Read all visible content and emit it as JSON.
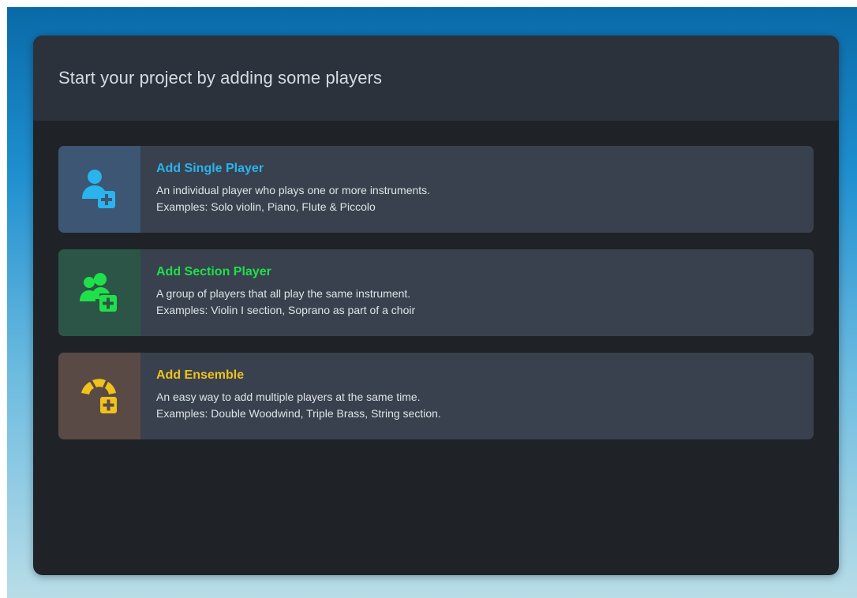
{
  "dialog": {
    "title": "Start your project by adding some players"
  },
  "options": [
    {
      "title": "Add Single Player",
      "line1": "An individual player who plays one or more instruments.",
      "line2": "Examples: Solo violin, Piano, Flute & Piccolo",
      "icon": "single-player-add-icon",
      "accent": "#2bb3ee"
    },
    {
      "title": "Add Section Player",
      "line1": "A group of players that all play the same instrument.",
      "line2": "Examples: Violin I section, Soprano as part of a choir",
      "icon": "section-player-add-icon",
      "accent": "#1fe04a"
    },
    {
      "title": "Add Ensemble",
      "line1": "An easy way to add multiple players at the same time.",
      "line2": "Examples: Double Woodwind, Triple Brass, String section.",
      "icon": "ensemble-add-icon",
      "accent": "#f0c21c"
    }
  ]
}
